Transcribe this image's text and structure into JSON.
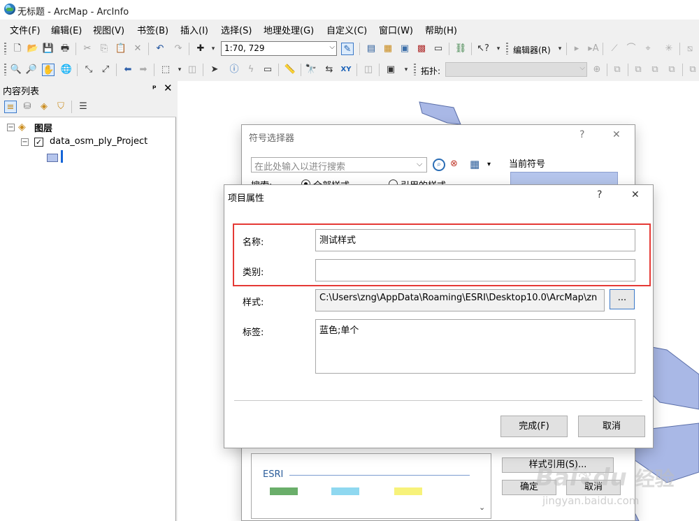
{
  "window": {
    "title": "无标题 - ArcMap - ArcInfo"
  },
  "menu": [
    "文件(F)",
    "编辑(E)",
    "视图(V)",
    "书签(B)",
    "插入(I)",
    "选择(S)",
    "地理处理(G)",
    "自定义(C)",
    "窗口(W)",
    "帮助(H)"
  ],
  "toolbar": {
    "scale_value": "1:70, 729",
    "editor_label": "编辑器(R)",
    "topology_label": "拓扑:"
  },
  "toc": {
    "title": "内容列表",
    "pin": "ᵩ",
    "close": "✕",
    "layers_group": "图层",
    "layer_name": "data_osm_ply_Project",
    "layer_checked": "✓"
  },
  "symbol_selector": {
    "title": "符号选择器",
    "help": "?",
    "close": "✕",
    "search_placeholder": "在此处输入以进行搜索",
    "current_symbol_label": "当前符号",
    "search_label": "搜索:",
    "option_all_styles": "全部样式",
    "option_referenced_styles": "引用的样式",
    "category_esri": "ESRI",
    "style_refs_button": "样式引用(S)...",
    "ok_button": "确定",
    "cancel_button": "取消"
  },
  "item_properties": {
    "title": "项目属性",
    "help": "?",
    "close": "✕",
    "name_label": "名称:",
    "name_value": "测试样式",
    "category_label": "类别:",
    "category_value": "",
    "style_label": "样式:",
    "style_value": "C:\\Users\\zng\\AppData\\Roaming\\ESRI\\Desktop10.0\\ArcMap\\zn",
    "browse_button": "...",
    "tags_label": "标签:",
    "tags_value": "蓝色;单个",
    "finish_button": "完成(F)",
    "cancel_button": "取消"
  },
  "watermark": {
    "brand": "Bai",
    "brand2": "du",
    "suffix": "经验",
    "url": "jingyan.baidu.com"
  },
  "colors": {
    "water": "#a9b8e6",
    "water_stroke": "#5a6ea8",
    "highlight": "#e53935",
    "swatch_green": "#6aae6a",
    "swatch_cyan": "#8fd8f0",
    "swatch_yellow": "#f7f27a",
    "current_symbol": "#b5c5ec"
  }
}
